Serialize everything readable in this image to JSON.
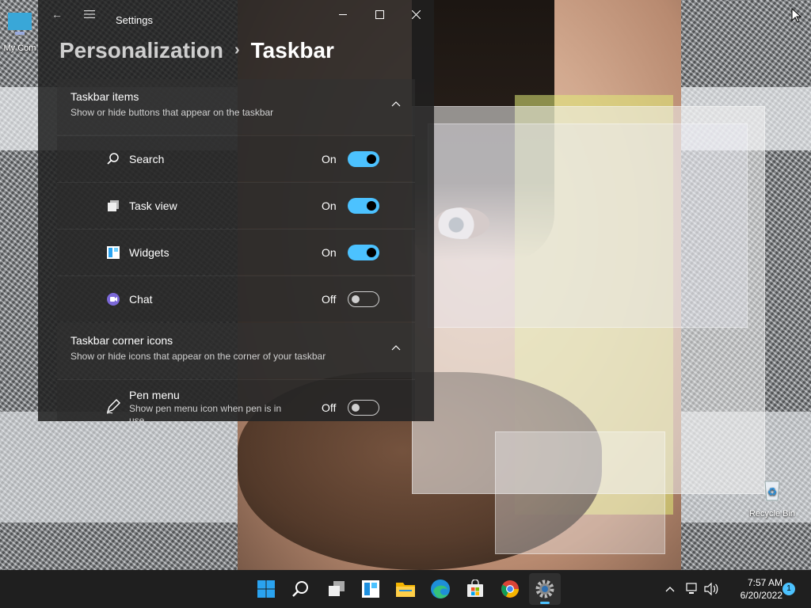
{
  "desktop": {
    "icons": [
      {
        "label": "My Com",
        "icon": "computer-icon"
      },
      {
        "label": "Recycle Bin",
        "icon": "recycle-bin-icon"
      }
    ]
  },
  "window": {
    "title": "Settings",
    "breadcrumb": {
      "parent": "Personalization",
      "separator": "›",
      "current": "Taskbar"
    }
  },
  "taskbar_items": {
    "title": "Taskbar items",
    "subtitle": "Show or hide buttons that appear on the taskbar",
    "rows": [
      {
        "label": "Search",
        "state": "On",
        "on": true,
        "icon": "search-icon"
      },
      {
        "label": "Task view",
        "state": "On",
        "on": true,
        "icon": "task-view-icon"
      },
      {
        "label": "Widgets",
        "state": "On",
        "on": true,
        "icon": "widgets-icon"
      },
      {
        "label": "Chat",
        "state": "Off",
        "on": false,
        "icon": "chat-icon"
      }
    ]
  },
  "corner_icons": {
    "title": "Taskbar corner icons",
    "subtitle": "Show or hide icons that appear on the corner of your taskbar",
    "rows": [
      {
        "label": "Pen menu",
        "sublabel": "Show pen menu icon when pen is in use",
        "state": "Off",
        "on": false,
        "icon": "pen-icon"
      }
    ]
  },
  "taskbar": {
    "apps": [
      "start-icon",
      "search-icon",
      "task-view-icon",
      "widgets-icon",
      "file-explorer-icon",
      "edge-icon",
      "store-icon",
      "chrome-icon",
      "settings-icon"
    ],
    "clock_time": "7:57 AM",
    "clock_date": "6/20/2022",
    "notification_count": "1"
  },
  "colors": {
    "accent": "#4cc2ff",
    "window_bg": "#202020",
    "taskbar_bg": "#1f1f1f"
  }
}
